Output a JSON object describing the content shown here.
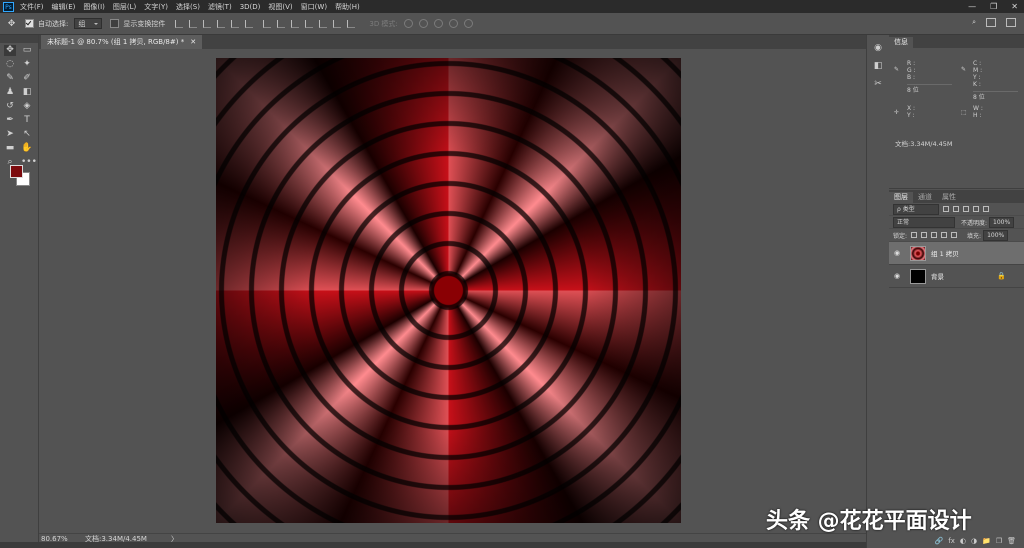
{
  "menubar": {
    "logo": "Ps",
    "items": [
      "文件(F)",
      "编辑(E)",
      "图像(I)",
      "图层(L)",
      "文字(Y)",
      "选择(S)",
      "滤镜(T)",
      "3D(D)",
      "视图(V)",
      "窗口(W)",
      "帮助(H)"
    ],
    "controls": [
      "—",
      "❐",
      "✕"
    ]
  },
  "options": {
    "auto_select_label": "自动选择:",
    "auto_select_value": "组",
    "show_transform_label": "显示变换控件",
    "threed_mode_label": "3D 模式:"
  },
  "tools": [
    [
      "move-tool",
      "✥",
      "artboard-tool",
      "▭"
    ],
    [
      "lasso-tool",
      "◌",
      "magic-wand-tool",
      "✦"
    ],
    [
      "eyedropper-tool",
      "✎",
      "brush-tool",
      "✐"
    ],
    [
      "stamp-tool",
      "♟",
      "eraser-tool",
      "◧"
    ],
    [
      "history-brush-tool",
      "↺",
      "bucket-tool",
      "◈"
    ],
    [
      "pen-tool",
      "✒",
      "type-tool",
      "T"
    ],
    [
      "path-select-tool",
      "➤",
      "direct-select-tool",
      "↖"
    ],
    [
      "rectangle-tool",
      "▬",
      "hand-tool",
      "✋"
    ],
    [
      "zoom-tool",
      "⌕",
      "more-tools",
      "•••"
    ]
  ],
  "document": {
    "tab_title": "未标题-1 @ 80.7% (组 1 拷贝, RGB/8#) *",
    "tab_close": "✕"
  },
  "status": {
    "zoom": "80.67%",
    "doc_size": "文档:3.34M/4.45M",
    "arrow": "〉"
  },
  "watermark": "头条 @花花平面设计",
  "info_panel": {
    "tab": "信息",
    "r": "R :",
    "g": "G :",
    "b": "B :",
    "c": "C :",
    "m": "M :",
    "y": "Y :",
    "k": "K :",
    "bit_left": "8 位",
    "bit_right": "8 位",
    "x": "X :",
    "y_coord": "Y :",
    "w": "W :",
    "h": "H :",
    "doc": "文档:3.34M/4.45M"
  },
  "layers_panel": {
    "tabs": [
      "图层",
      "通道",
      "属性"
    ],
    "filter": "ρ 类型",
    "blend_mode": "正常",
    "opacity_label": "不透明度:",
    "opacity_value": "100%",
    "lock_label": "锁定:",
    "fill_label": "填充:",
    "fill_value": "100%",
    "layers": [
      {
        "name": "组 1 拷贝",
        "selected": true
      },
      {
        "name": "背景",
        "locked": true
      }
    ],
    "footer_icons": [
      "🔗",
      "fx",
      "◐",
      "◑",
      "📁",
      "❐",
      "🗑"
    ]
  },
  "colors": {
    "foreground": "#7c0b0e",
    "background": "#ffffff"
  }
}
